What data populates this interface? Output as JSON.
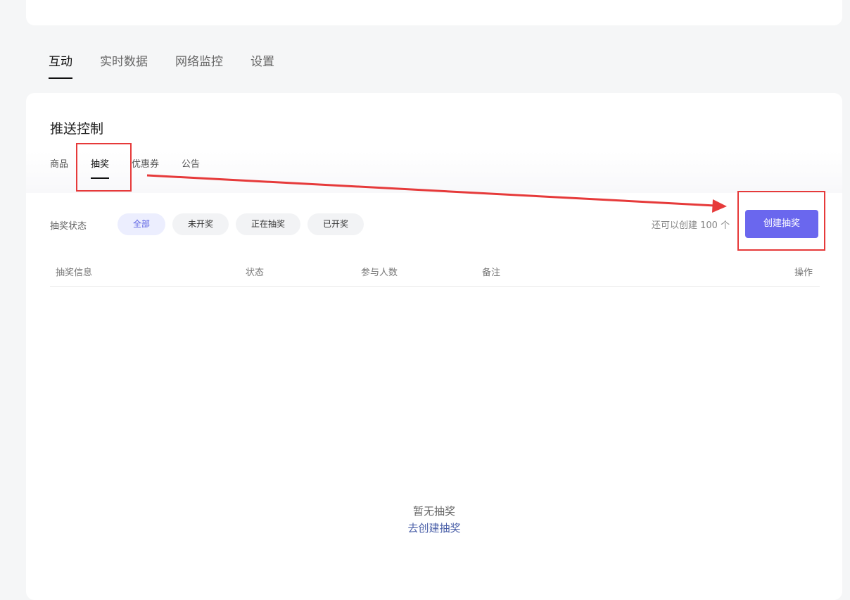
{
  "main_tabs": [
    "互动",
    "实时数据",
    "网络监控",
    "设置"
  ],
  "panel": {
    "title": "推送控制",
    "sub_tabs": [
      "商品",
      "抽奖",
      "优惠券",
      "公告"
    ],
    "filter_label": "抽奖状态",
    "filters": [
      "全部",
      "未开奖",
      "正在抽奖",
      "已开奖"
    ],
    "quota_text": "还可以创建 100 个",
    "create_button": "创建抽奖",
    "table_headers": [
      "抽奖信息",
      "状态",
      "参与人数",
      "备注",
      "操作"
    ],
    "empty_text": "暂无抽奖",
    "empty_link": "去创建抽奖"
  },
  "colors": {
    "accent": "#6a67ee",
    "annotation": "#e63a3a",
    "link": "#4a5fa8"
  }
}
